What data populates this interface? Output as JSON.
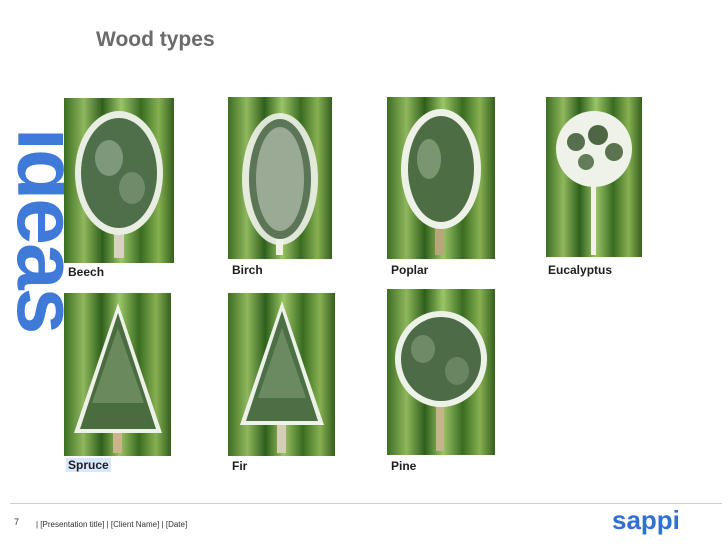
{
  "brand": {
    "side_text": "ideas",
    "logo": "sappi",
    "accent": "#2f6fd6"
  },
  "slide": {
    "title": "Wood types"
  },
  "trees": [
    {
      "name": "Beech",
      "shape": "round"
    },
    {
      "name": "Birch",
      "shape": "weeping"
    },
    {
      "name": "Poplar",
      "shape": "tall"
    },
    {
      "name": "Eucalyptus",
      "shape": "sparse"
    },
    {
      "name": "Spruce",
      "shape": "conifer"
    },
    {
      "name": "Fir",
      "shape": "conifer"
    },
    {
      "name": "Pine",
      "shape": "pine"
    }
  ],
  "footer": {
    "page_number": "7",
    "text": "|   [Presentation title]   |   [Client Name]   |   [Date]"
  }
}
